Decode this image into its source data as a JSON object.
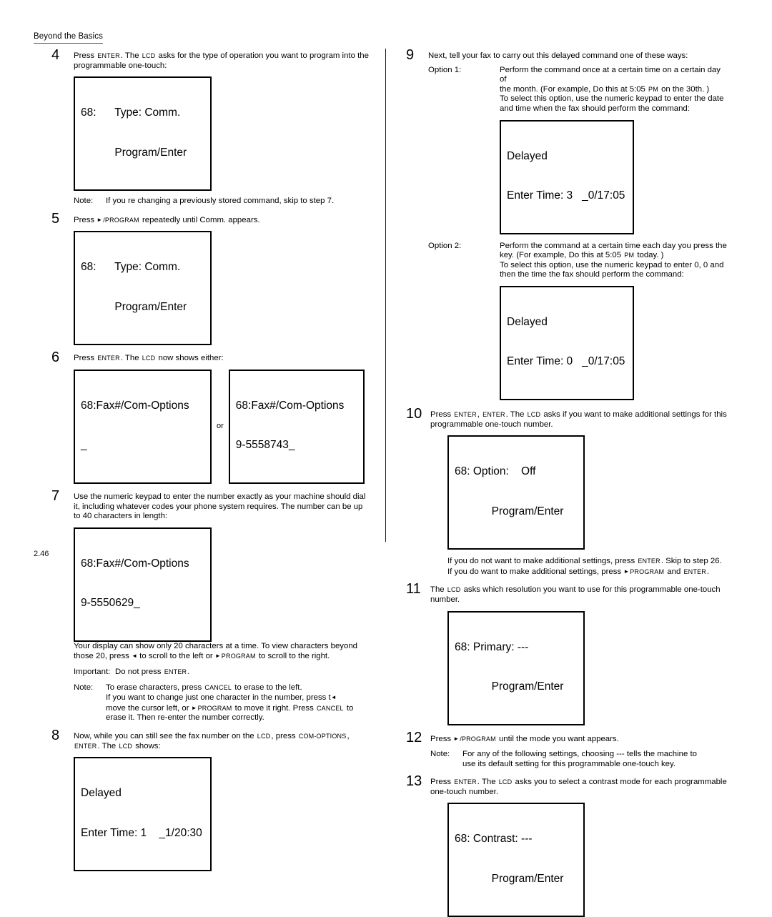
{
  "header": {
    "title": "Beyond the Basics"
  },
  "footer": {
    "page_number": "2.46"
  },
  "keys": {
    "enter": "ENTER",
    "cancel": "CANCEL",
    "program": "PROGRAM",
    "com_options": "COM-OPTIONS",
    "lcd": "LCD",
    "pm": "PM"
  },
  "left_column": {
    "steps": [
      {
        "number": "4",
        "text_parts": {
          "a": "Press ",
          "key1": "ENTER",
          "b": ". The ",
          "key2": "LCD",
          "c": " asks for the type of operation you want to program into the programmable one-touch:"
        },
        "lcd": {
          "line1": "68:      Type: Comm.",
          "line2": "           Program/Enter"
        },
        "note": {
          "label": "Note:",
          "text": "If you re changing a previously stored command, skip to step 7."
        }
      },
      {
        "number": "5",
        "text_parts": {
          "a": "Press ",
          "key1": "/PROGRAM",
          "b": " repeatedly until   Comm.  appears."
        },
        "lcd": {
          "line1": "68:      Type: Comm.",
          "line2": "           Program/Enter"
        }
      },
      {
        "number": "6",
        "text_parts": {
          "a": "Press ",
          "key1": "ENTER",
          "b": ". The ",
          "key2": "LCD",
          "c": " now shows either:"
        },
        "lcd_a": {
          "line1": "68:Fax#/Com-Options",
          "line2": "_"
        },
        "or_label": "or",
        "lcd_b": {
          "line1": "68:Fax#/Com-Options",
          "line2": "9-5558743_"
        }
      },
      {
        "number": "7",
        "text": "Use the numeric keypad to enter the number   exactly as your machine should dial it, including whatever codes your phone system requires. The number can be up to 40 characters in length:",
        "lcd": {
          "line1": "68:Fax#/Com-Options",
          "line2": "9-5550629_"
        },
        "para_parts": {
          "a": "Your display can show only 20 characters at a time. To view characters beyond those 20, press ",
          "b": " to scroll to the left or   ",
          "key": "PROGRAM",
          "c": " to scroll to the right."
        },
        "important": {
          "label": "Important:",
          "text_a": "Do not  press ",
          "key": "ENTER",
          "text_b": "."
        },
        "note": {
          "label": "Note:",
          "line1_a": "To erase characters, press ",
          "line1_key": "CANCEL",
          "line1_b": " to erase to the left.",
          "line2": "If you want to change just one character in the number, press      t",
          "line3_a": "move the cursor left, or   ",
          "line3_key": "PROGRAM",
          "line3_b": " to move it right. Press   ",
          "line3_key2": "CANCEL",
          "line3_c": " to",
          "line4": "erase it. Then re-enter the number correctly."
        }
      },
      {
        "number": "8",
        "text_parts": {
          "a": "Now, while you can still see the fax number on the ",
          "key1": "LCD",
          "b": ", press ",
          "key2": "COM-OPTIONS",
          "c": ", ",
          "key3": "ENTER",
          "d": ". The ",
          "key4": "LCD",
          "e": " shows:"
        },
        "lcd": {
          "line1": "Delayed",
          "line2": "Enter Time: 1    _1/20:30"
        }
      }
    ]
  },
  "right_column": {
    "steps": [
      {
        "number": "9",
        "text": "Next, tell your fax to carry out this delayed command one of these ways:",
        "option1": {
          "label": "Option 1:",
          "line1": "Perform the command  once at a certain time on a certain day of",
          "line2_a": "the month. (For example,  Do this at 5:05  ",
          "line2_key": "PM",
          "line2_b": " on the 30th. )",
          "line3": "To select this option, use the numeric keypad to enter the date",
          "line4": "and time when the fax should perform the command:",
          "lcd": {
            "line1": "Delayed",
            "line2": "Enter Time: 3   _0/17:05"
          }
        },
        "option2": {
          "label": "Option 2:",
          "line1": "Perform the command at a certain time    each day you press the",
          "line2_a": "key. (For example,  Do this at 5:05  ",
          "line2_key": "PM",
          "line2_b": " today. )",
          "line3": "To select this option, use the numeric keypad to enter     0, 0 and",
          "line4": "then the time the fax should perform the command:",
          "lcd": {
            "line1": "Delayed",
            "line2": "Enter Time: 0   _0/17:05"
          }
        }
      },
      {
        "number": "10",
        "text_parts": {
          "a": "Press ",
          "key1": "ENTER",
          "b": ", ",
          "key2": "ENTER",
          "c": ". The ",
          "key3": "LCD",
          "d": " asks if you want to make additional settings for this programmable one-touch number."
        },
        "lcd": {
          "line1": "68: Option:    Off",
          "line2": "            Program/Enter"
        },
        "para": {
          "line1_a": "If you  do not want to make additional settings, press   ",
          "line1_key": "ENTER",
          "line1_b": ". Skip to step 26.",
          "line2_a": "If you  do want to make additional settings, press   ",
          "line2_key": "PROGRAM",
          "line2_b": " and ",
          "line2_key2": "ENTER",
          "line2_c": "."
        }
      },
      {
        "number": "11",
        "text_parts": {
          "a": "The ",
          "key1": "LCD",
          "b": " asks which resolution you want to use for this programmable one-touch number."
        },
        "lcd": {
          "line1": "68: Primary: ---",
          "line2": "            Program/Enter"
        }
      },
      {
        "number": "12",
        "text_parts": {
          "a": "Press ",
          "key1": "/PROGRAM",
          "b": " until the mode you want appears."
        },
        "note": {
          "label": "Note:",
          "line1": "For any of the following settings, choosing  ---  tells the machine to",
          "line2": "use its default  setting for this programmable one-touch key."
        }
      },
      {
        "number": "13",
        "text_parts": {
          "a": "Press ",
          "key1": "ENTER",
          "b": ". The ",
          "key2": "LCD",
          "c": " asks you to select a contrast mode for each programmable one-touch number."
        },
        "lcd": {
          "line1": "68: Contrast: ---",
          "line2": "            Program/Enter"
        }
      }
    ]
  }
}
